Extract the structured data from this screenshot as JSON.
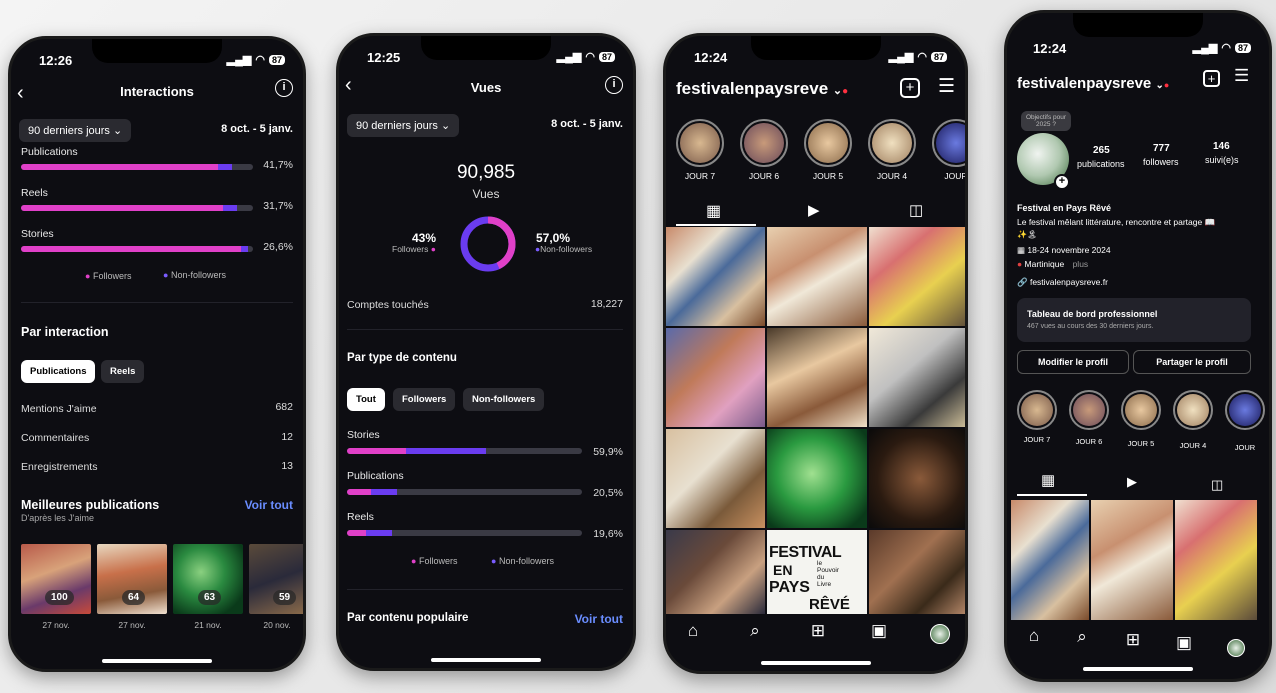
{
  "p1": {
    "time": "12:26",
    "battery": "87",
    "title": "Interactions",
    "range_pill": "90 derniers jours ⌄",
    "date_range": "8 oct. - 5 janv.",
    "bars": [
      {
        "label": "Publications",
        "pct": "41,7%",
        "followers": 0.85,
        "non_followers": 0.06
      },
      {
        "label": "Reels",
        "pct": "31,7%",
        "followers": 0.87,
        "non_followers": 0.06
      },
      {
        "label": "Stories",
        "pct": "26,6%",
        "followers": 0.95,
        "non_followers": 0.03
      }
    ],
    "legend_followers": "Followers",
    "legend_non_followers": "Non-followers",
    "section_title": "Par interaction",
    "tab_pub": "Publications",
    "tab_reels": "Reels",
    "rows": [
      {
        "label": "Mentions J'aime",
        "value": "682"
      },
      {
        "label": "Commentaires",
        "value": "12"
      },
      {
        "label": "Enregistrements",
        "value": "13"
      }
    ],
    "best_title": "Meilleures publications",
    "best_sub": "D'après les J'aime",
    "voir_tout": "Voir tout",
    "thumbs": [
      {
        "count": "100",
        "date": "27 nov."
      },
      {
        "count": "64",
        "date": "27 nov."
      },
      {
        "count": "63",
        "date": "21 nov."
      },
      {
        "count": "59",
        "date": "20 nov."
      }
    ]
  },
  "p2": {
    "time": "12:25",
    "battery": "87",
    "title": "Vues",
    "range_pill": "90 derniers jours ⌄",
    "date_range": "8 oct. - 5 janv.",
    "total": "90,985",
    "total_label": "Vues",
    "followers_pct": "43%",
    "followers_label": "Followers",
    "non_followers_pct": "57,0%",
    "non_followers_label": "Non-followers",
    "reach_label": "Comptes touchés",
    "reach_value": "18,227",
    "section_title": "Par type de contenu",
    "tab_all": "Tout",
    "tab_followers": "Followers",
    "tab_non_followers": "Non-followers",
    "bars": [
      {
        "label": "Stories",
        "pct": "59,9%",
        "followers": 0.25,
        "non_followers": 0.34
      },
      {
        "label": "Publications",
        "pct": "20,5%",
        "followers": 0.1,
        "non_followers": 0.11
      },
      {
        "label": "Reels",
        "pct": "19,6%",
        "followers": 0.08,
        "non_followers": 0.11
      }
    ],
    "legend_followers": "Followers",
    "legend_non_followers": "Non-followers",
    "popular_title": "Par contenu populaire",
    "voir_tout": "Voir tout"
  },
  "p3": {
    "time": "12:24",
    "battery": "87",
    "username": "festivalenpaysreve",
    "stories": [
      "JOUR 7",
      "JOUR 6",
      "JOUR 5",
      "JOUR 4",
      "JOUR"
    ],
    "poster_lines": [
      "FESTIVAL",
      "EN",
      "PAYS",
      "RÊVÉ",
      "le",
      "Pouvoir",
      "du",
      "Livre"
    ]
  },
  "p4": {
    "time": "12:24",
    "battery": "87",
    "username": "festivalenpaysreve",
    "note": "Objectifs pour 2025 ?",
    "stats": [
      {
        "value": "265",
        "label": "publications"
      },
      {
        "value": "777",
        "label": "followers"
      },
      {
        "value": "146",
        "label": "suivi(e)s"
      }
    ],
    "name": "Festival en Pays Rêvé",
    "bio1": "Le festival mêlant littérature, rencontre et partage 📖",
    "bio2": "18-24 novembre 2024",
    "bio3": "Martinique",
    "bio_more": "plus",
    "website": "festivalenpaysreve.fr",
    "dash_title": "Tableau de bord professionnel",
    "dash_sub": "467 vues au cours des 30 derniers jours.",
    "edit_btn": "Modifier le profil",
    "share_btn": "Partager le profil",
    "stories": [
      "JOUR 7",
      "JOUR 6",
      "JOUR 5",
      "JOUR 4",
      "JOUR"
    ]
  },
  "colors": {
    "followers": "#e040c8",
    "non_followers": "#6a3cf0",
    "link": "#6a8dff"
  }
}
